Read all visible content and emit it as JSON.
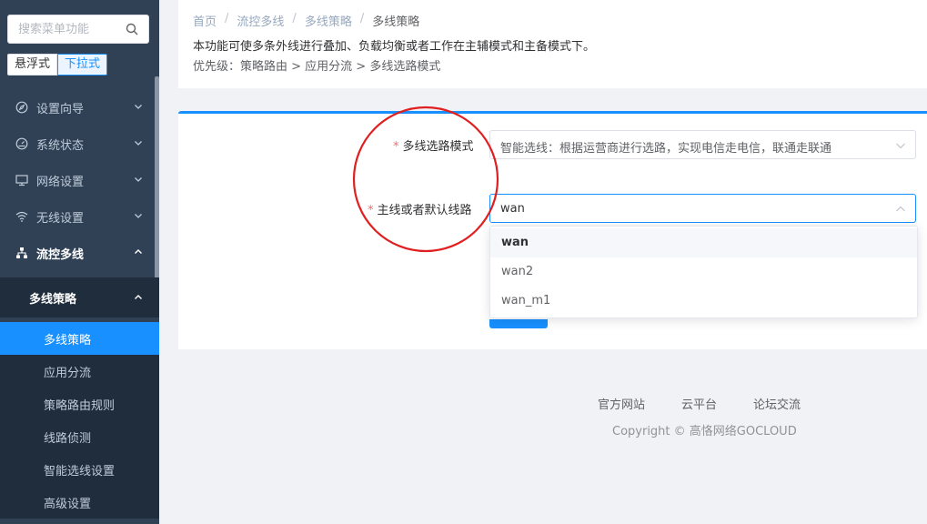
{
  "sidebar": {
    "search": {
      "placeholder": "搜索菜单功能"
    },
    "modes": [
      "悬浮式",
      "下拉式"
    ],
    "menu": [
      {
        "label": "设置向导",
        "icon": "compass-icon"
      },
      {
        "label": "系统状态",
        "icon": "dashboard-icon"
      },
      {
        "label": "网络设置",
        "icon": "monitor-icon"
      },
      {
        "label": "无线设置",
        "icon": "wifi-icon"
      },
      {
        "label": "流控多线",
        "icon": "network-icon"
      }
    ],
    "submenu_title": "多线策略",
    "leaves": [
      "多线策略",
      "应用分流",
      "策略路由规则",
      "线路侦测",
      "智能选线设置",
      "高级设置"
    ]
  },
  "breadcrumb": [
    "首页",
    "流控多线",
    "多线策略",
    "多线策略"
  ],
  "breadcrumb_sep": "/",
  "description": {
    "line1": "本功能可使多条外线进行叠加、负载均衡或者工作在主辅模式和主备模式下。",
    "line2": "优先级：策略路由 > 应用分流 > 多线选路模式"
  },
  "form": {
    "required_mark": "*",
    "mode_label": "多线选路模式",
    "mode_value": "智能选线：根据运营商进行选路，实现电信走电信，联通走联通",
    "line_label": "主线或者默认线路",
    "line_value": "wan"
  },
  "dropdown": {
    "options": [
      "wan",
      "wan2",
      "wan_m1"
    ],
    "selected": "wan"
  },
  "footer": {
    "links": [
      "官方网站",
      "云平台",
      "论坛交流"
    ],
    "copyright": "Copyright © 高恪网络GOCLOUD"
  },
  "colors": {
    "sidebar_bg": "#304156",
    "accent": "#1890ff",
    "required": "#f56c6c",
    "annotation": "#e02020"
  }
}
